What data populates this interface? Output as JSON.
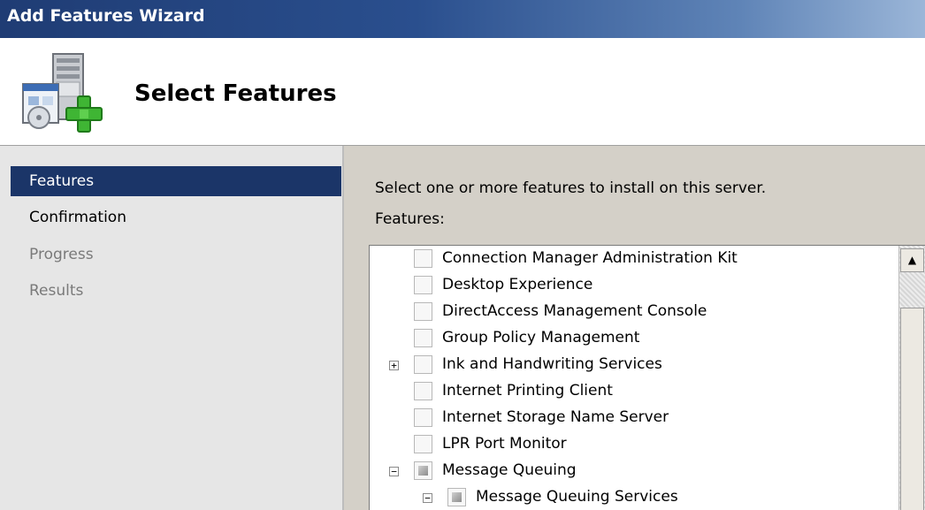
{
  "window": {
    "title": "Add Features Wizard"
  },
  "header": {
    "title": "Select Features",
    "icon": "server-add-icon"
  },
  "nav": {
    "items": [
      {
        "label": "Features",
        "state": "active"
      },
      {
        "label": "Confirmation",
        "state": "normal"
      },
      {
        "label": "Progress",
        "state": "disabled"
      },
      {
        "label": "Results",
        "state": "disabled"
      }
    ]
  },
  "main": {
    "instruction": "Select one or more features to install on this server.",
    "features_label": "Features:",
    "features": [
      {
        "label": "Connection Manager Administration Kit",
        "checked": "unchecked",
        "expander": ""
      },
      {
        "label": "Desktop Experience",
        "checked": "unchecked",
        "expander": ""
      },
      {
        "label": "DirectAccess Management Console",
        "checked": "unchecked",
        "expander": ""
      },
      {
        "label": "Group Policy Management",
        "checked": "unchecked",
        "expander": ""
      },
      {
        "label": "Ink and Handwriting Services",
        "checked": "unchecked",
        "expander": "+"
      },
      {
        "label": "Internet Printing Client",
        "checked": "unchecked",
        "expander": ""
      },
      {
        "label": "Internet Storage Name Server",
        "checked": "unchecked",
        "expander": ""
      },
      {
        "label": "LPR Port Monitor",
        "checked": "unchecked",
        "expander": ""
      },
      {
        "label": "Message Queuing",
        "checked": "partial",
        "expander": "−"
      },
      {
        "label": "Message Queuing Services",
        "checked": "partial",
        "expander": "−"
      }
    ]
  },
  "scrollbar": {
    "up_arrow": "▲"
  }
}
